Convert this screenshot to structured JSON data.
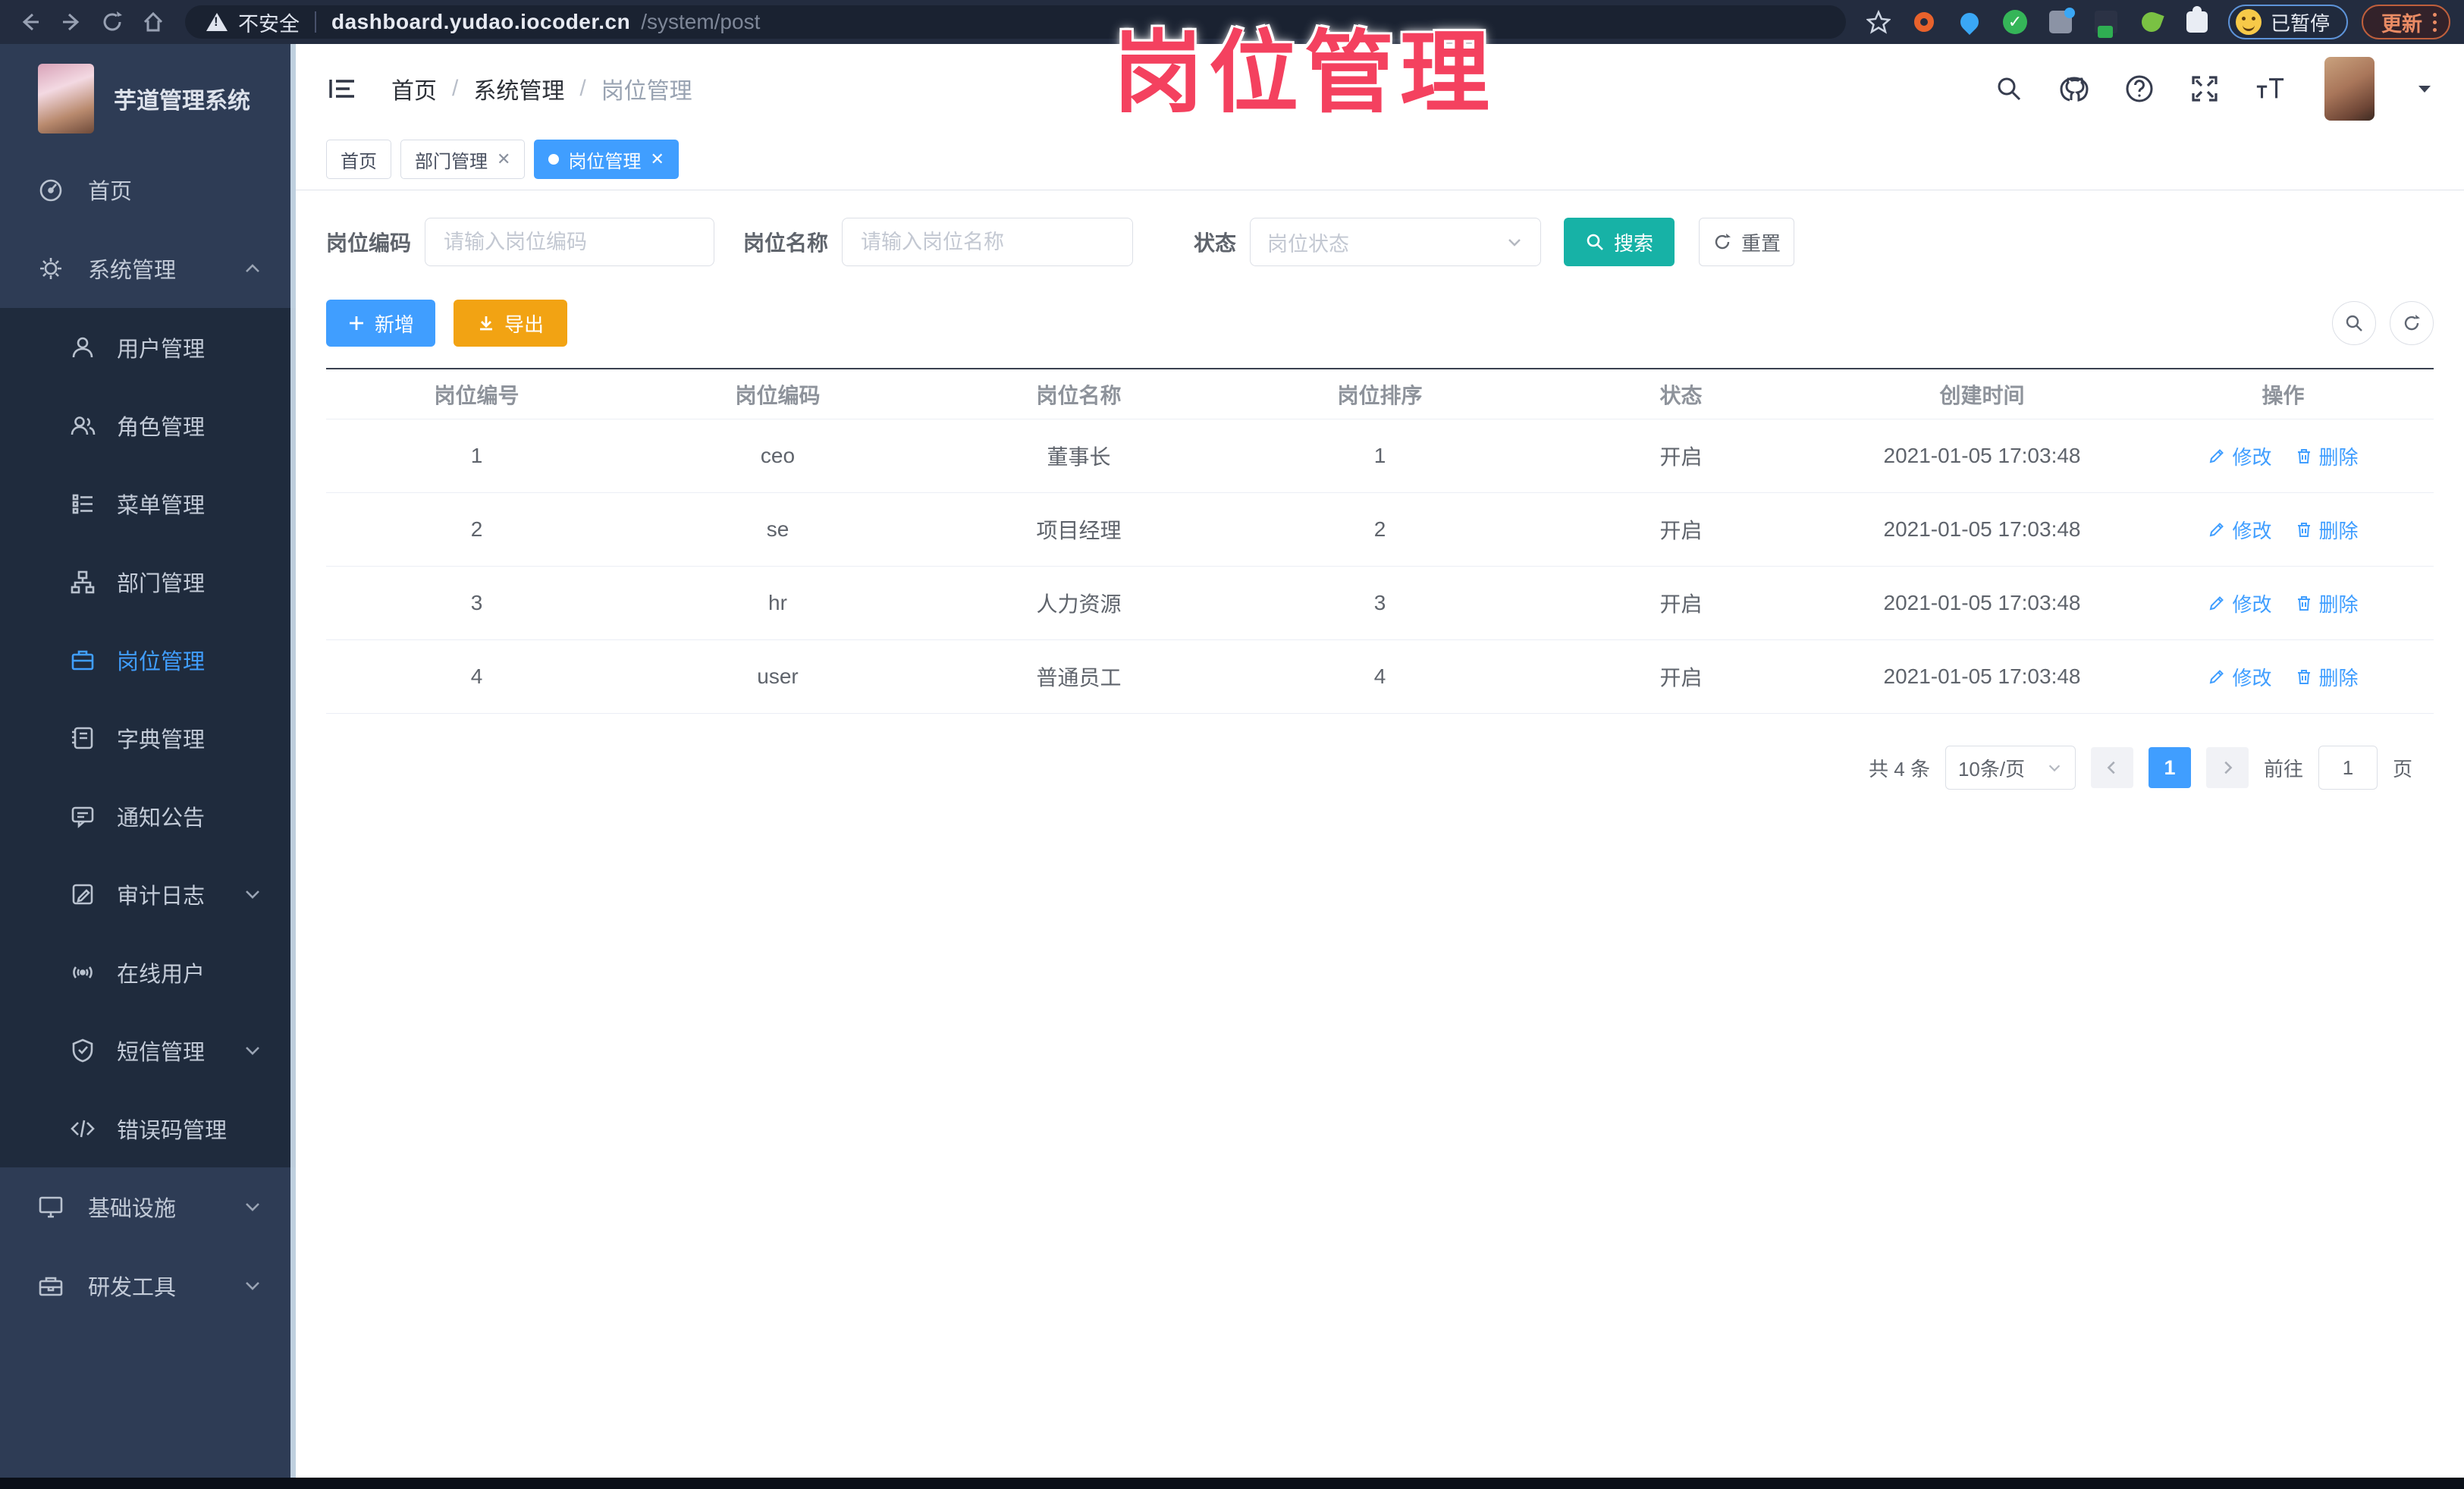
{
  "colors": {
    "accent": "#409EFF",
    "search_button": "#17B2A6",
    "export_button": "#F2A313",
    "overlay_pink": "#F4415F",
    "sidebar_bg": "#2e3c55",
    "submenu_bg": "#1f2b3d"
  },
  "overlay_title": "岗位管理",
  "browser": {
    "security_label": "不安全",
    "url_host": "dashboard.yudao.iocoder.cn",
    "url_path": "/system/post",
    "paused_label": "已暂停",
    "update_label": "更新"
  },
  "sidebar": {
    "app_title": "芋道管理系统",
    "home": "首页",
    "system": "系统管理",
    "sub": [
      "用户管理",
      "角色管理",
      "菜单管理",
      "部门管理",
      "岗位管理",
      "字典管理",
      "通知公告",
      "审计日志",
      "在线用户",
      "短信管理",
      "错误码管理"
    ],
    "infra": "基础设施",
    "devtools": "研发工具"
  },
  "navbar": {
    "breadcrumb": [
      "首页",
      "系统管理",
      "岗位管理"
    ],
    "separator": "/"
  },
  "tabs": {
    "items": [
      {
        "label": "首页"
      },
      {
        "label": "部门管理"
      },
      {
        "label": "岗位管理"
      }
    ]
  },
  "filters": {
    "post_code_label": "岗位编码",
    "post_code_placeholder": "请输入岗位编码",
    "post_name_label": "岗位名称",
    "post_name_placeholder": "请输入岗位名称",
    "status_label": "状态",
    "status_placeholder": "岗位状态",
    "search_label": "搜索",
    "reset_label": "重置"
  },
  "toolbar": {
    "add_label": "新增",
    "export_label": "导出"
  },
  "table": {
    "columns": [
      "岗位编号",
      "岗位编码",
      "岗位名称",
      "岗位排序",
      "状态",
      "创建时间",
      "操作"
    ],
    "rows": [
      {
        "id": "1",
        "code": "ceo",
        "name": "董事长",
        "sort": "1",
        "status": "开启",
        "created": "2021-01-05 17:03:48"
      },
      {
        "id": "2",
        "code": "se",
        "name": "项目经理",
        "sort": "2",
        "status": "开启",
        "created": "2021-01-05 17:03:48"
      },
      {
        "id": "3",
        "code": "hr",
        "name": "人力资源",
        "sort": "3",
        "status": "开启",
        "created": "2021-01-05 17:03:48"
      },
      {
        "id": "4",
        "code": "user",
        "name": "普通员工",
        "sort": "4",
        "status": "开启",
        "created": "2021-01-05 17:03:48"
      }
    ],
    "actions": {
      "edit": "修改",
      "delete": "删除"
    }
  },
  "pagination": {
    "total": "共 4 条",
    "page_size": "10条/页",
    "page": "1",
    "goto_label": "前往",
    "goto_value": "1",
    "unit_label": "页"
  }
}
